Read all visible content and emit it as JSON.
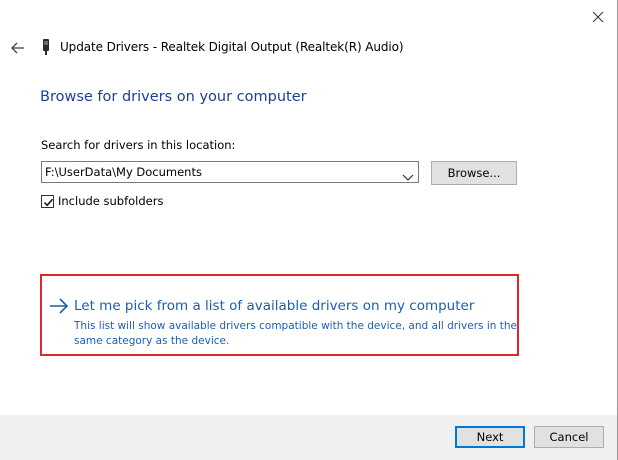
{
  "window": {
    "title": "Update Drivers - Realtek Digital Output (Realtek(R) Audio)"
  },
  "page": {
    "heading": "Browse for drivers on your computer",
    "search_label": "Search for drivers in this location:",
    "path_value": "F:\\UserData\\My Documents",
    "browse_label": "Browse...",
    "include_subfolders_label": "Include subfolders",
    "include_subfolders_checked": true
  },
  "pick_option": {
    "link": "Let me pick from a list of available drivers on my computer",
    "description": "This list will show available drivers compatible with the device, and all drivers in the same category as the device."
  },
  "footer": {
    "next_label": "Next",
    "cancel_label": "Cancel"
  },
  "colors": {
    "heading": "#1f3d99",
    "link": "#1a5fb4",
    "highlight_border": "#e0282b",
    "default_button_border": "#0078d7"
  },
  "icons": {
    "back": "back-arrow-icon",
    "device": "device-icon",
    "close": "close-icon",
    "dropdown": "chevron-down-icon",
    "check": "checkmark-icon",
    "link_arrow": "right-arrow-icon"
  }
}
